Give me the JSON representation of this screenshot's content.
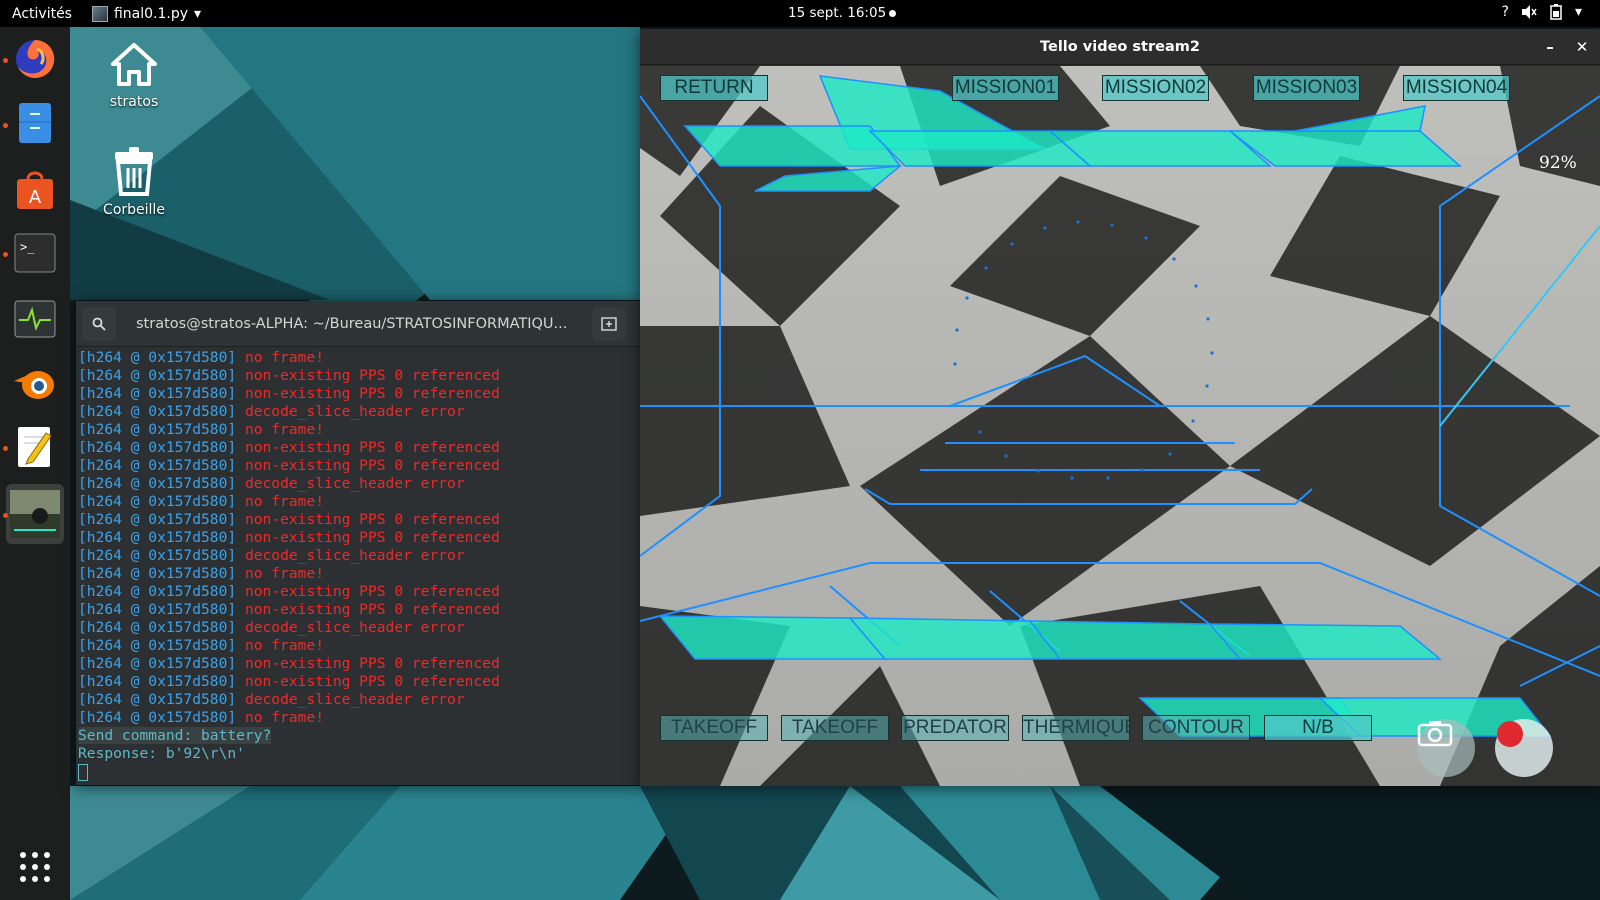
{
  "topbar": {
    "activities": "Activités",
    "app_name": "final0.1.py",
    "clock": "15 sept.  16:05"
  },
  "dock": {
    "items": [
      "firefox-icon",
      "files-icon",
      "software-center-icon",
      "terminal-icon",
      "system-monitor-icon",
      "blender-icon",
      "text-editor-icon",
      "tello-video-icon",
      "show-apps-icon"
    ]
  },
  "desktop": {
    "home_label": "stratos",
    "trash_label": "Corbeille"
  },
  "terminal": {
    "title": "stratos@stratos-ALPHA: ~/Bureau/STRATOSINFORMATIQU...",
    "prefix": "[h264 @ 0x157d580]",
    "lines": [
      "no frame!",
      "non-existing PPS 0 referenced",
      "non-existing PPS 0 referenced",
      "decode_slice_header error",
      "no frame!",
      "non-existing PPS 0 referenced",
      "non-existing PPS 0 referenced",
      "decode_slice_header error",
      "no frame!",
      "non-existing PPS 0 referenced",
      "non-existing PPS 0 referenced",
      "decode_slice_header error",
      "no frame!",
      "non-existing PPS 0 referenced",
      "non-existing PPS 0 referenced",
      "decode_slice_header error",
      "no frame!",
      "non-existing PPS 0 referenced",
      "non-existing PPS 0 referenced",
      "decode_slice_header error",
      "no frame!"
    ],
    "command_line": "Send command: battery?",
    "response_line": "Response: b'92\\r\\n'"
  },
  "tello": {
    "title": "Tello video stream2",
    "battery": "92%",
    "top_buttons": [
      "RETURN",
      "MISSION01",
      "MISSION02",
      "MISSION03",
      "MISSION04"
    ],
    "bottom_buttons": [
      "TAKEOFF",
      "TAKEOFF",
      "PREDATOR",
      "THERMIQUE",
      "CONTOUR",
      "N/B"
    ],
    "accent_color": "#1de9c4",
    "hud_line_color": "#1e90ff"
  }
}
